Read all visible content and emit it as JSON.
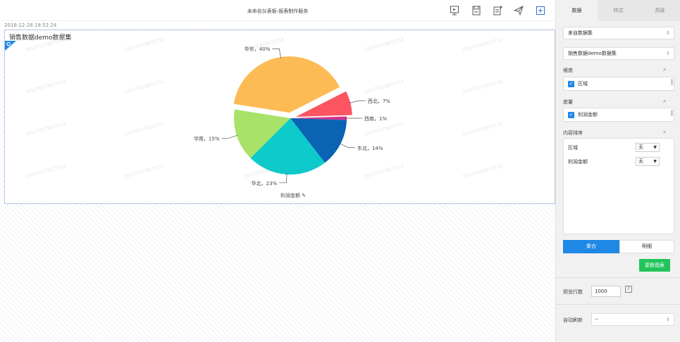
{
  "topbar": {
    "title": "未命名仪表板-报表制作服务",
    "icons": [
      "presentation-icon",
      "save-icon",
      "save-as-icon",
      "send-icon",
      "add-widget-icon"
    ]
  },
  "timestamp": "2016-12-28 18:52:24",
  "widget": {
    "title": "销售数据demo数据集",
    "field_label": "利润金额",
    "watermark": "191476379872714"
  },
  "chart_data": {
    "type": "pie",
    "title": "",
    "series_label": "利润金额",
    "slices": [
      {
        "label": "华东",
        "value": 40,
        "color": "#fdbb56",
        "exploded": true
      },
      {
        "label": "西北",
        "value": 7,
        "color": "#fc5561",
        "exploded": true
      },
      {
        "label": "西南",
        "value": 1,
        "color": "#d72f8c",
        "exploded": false
      },
      {
        "label": "东北",
        "value": 14,
        "color": "#0a63b3",
        "exploded": false
      },
      {
        "label": "华北",
        "value": 23,
        "color": "#0ecaca",
        "exploded": false
      },
      {
        "label": "华南",
        "value": 15,
        "color": "#a9e268",
        "exploded": false
      }
    ],
    "label_format": "{label}，{value}%"
  },
  "panel": {
    "tabs": [
      "数据",
      "样式",
      "高级"
    ],
    "active_tab": 0,
    "source_select": "来自数据集",
    "dataset_select": "销售数据demo数据集",
    "dimension_label": "维度",
    "dimension_item": "区域",
    "measure_label": "度量",
    "measure_item": "利润金额",
    "sort_label": "内容排序",
    "sort_rows": [
      {
        "field": "区域",
        "value": "无"
      },
      {
        "field": "利润金额",
        "value": "无"
      }
    ],
    "mode_agg": "聚合",
    "mode_detail": "明细",
    "update_button": "更新图表",
    "preview_label": "预览行数",
    "preview_value": "1000",
    "preview_help": "?",
    "auto_refresh_label": "自动刷新",
    "auto_refresh_value": "--"
  },
  "colors": {
    "accent": "#1e88e5",
    "update": "#21c45a"
  }
}
